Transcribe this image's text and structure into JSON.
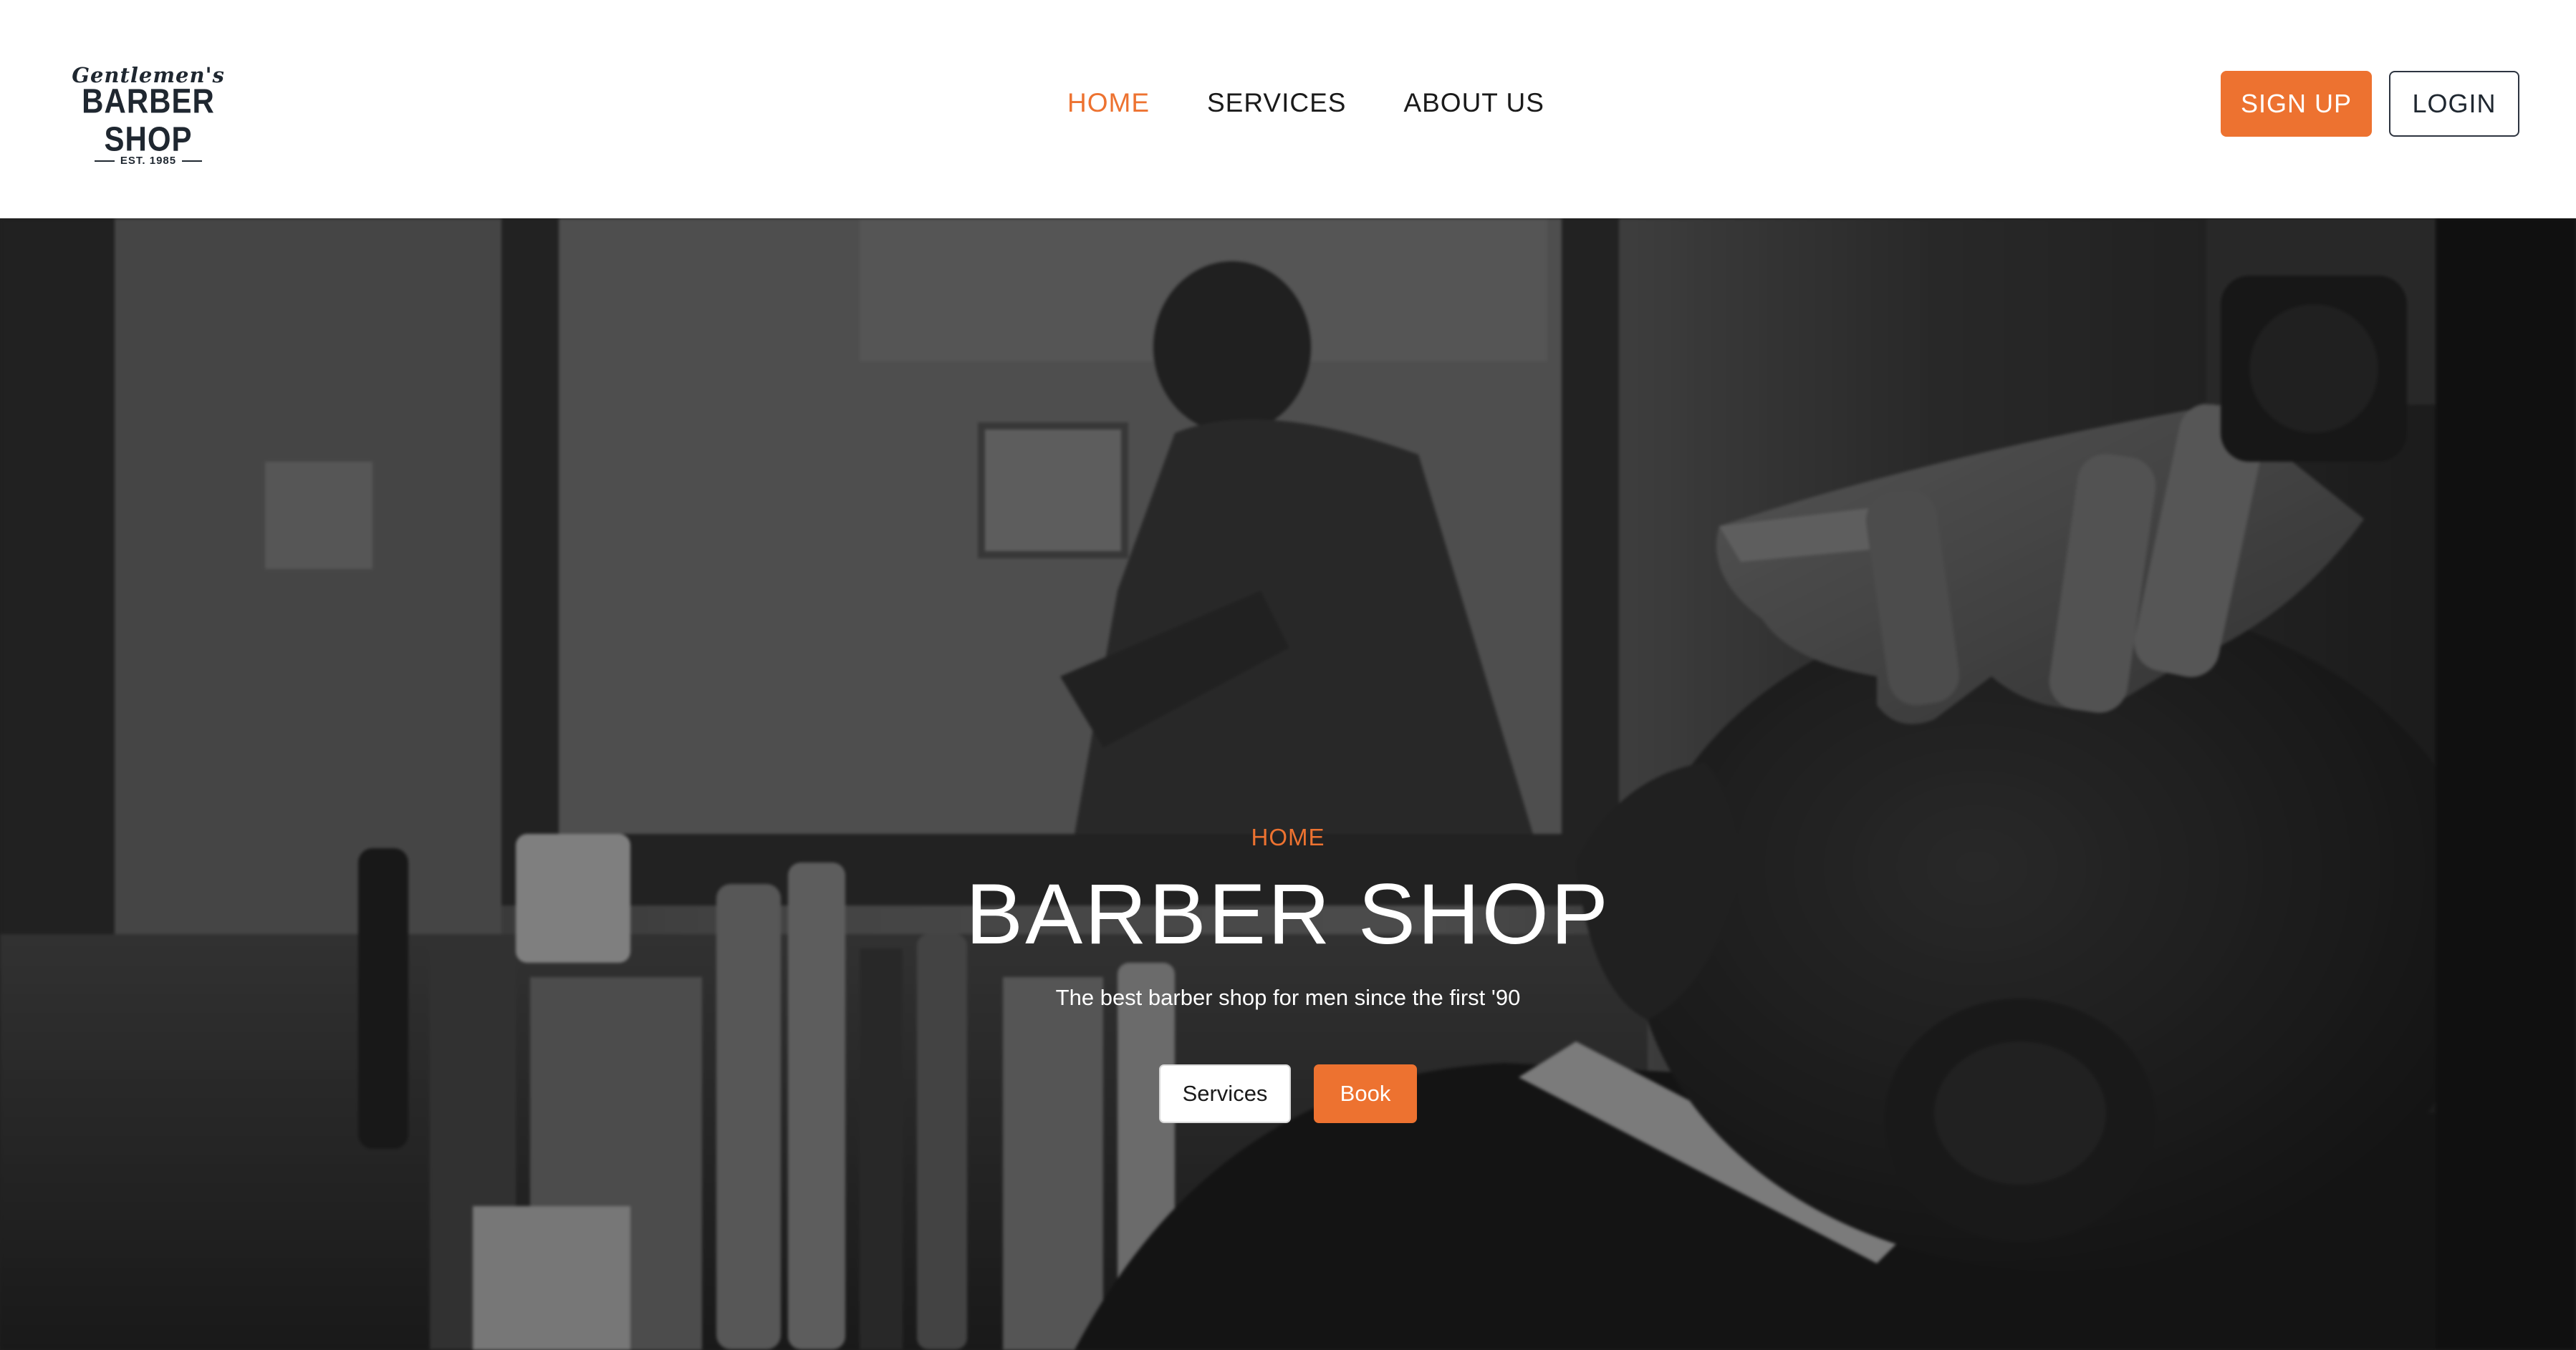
{
  "brand": {
    "script": "Gentlemen's",
    "name": "BARBER SHOP",
    "est": "EST. 1985"
  },
  "nav": {
    "items": [
      {
        "label": "HOME",
        "active": true
      },
      {
        "label": "SERVICES",
        "active": false
      },
      {
        "label": "ABOUT US",
        "active": false
      }
    ]
  },
  "auth": {
    "signup_label": "SIGN UP",
    "login_label": "LOGIN"
  },
  "hero": {
    "eyebrow": "HOME",
    "title": "BARBER SHOP",
    "subtitle": "The best barber shop for men since the first '90",
    "services_label": "Services",
    "book_label": "Book",
    "image": "grayscale barber shop photo"
  },
  "colors": {
    "accent": "#ed7230",
    "dark": "#1f2730",
    "white": "#ffffff"
  }
}
